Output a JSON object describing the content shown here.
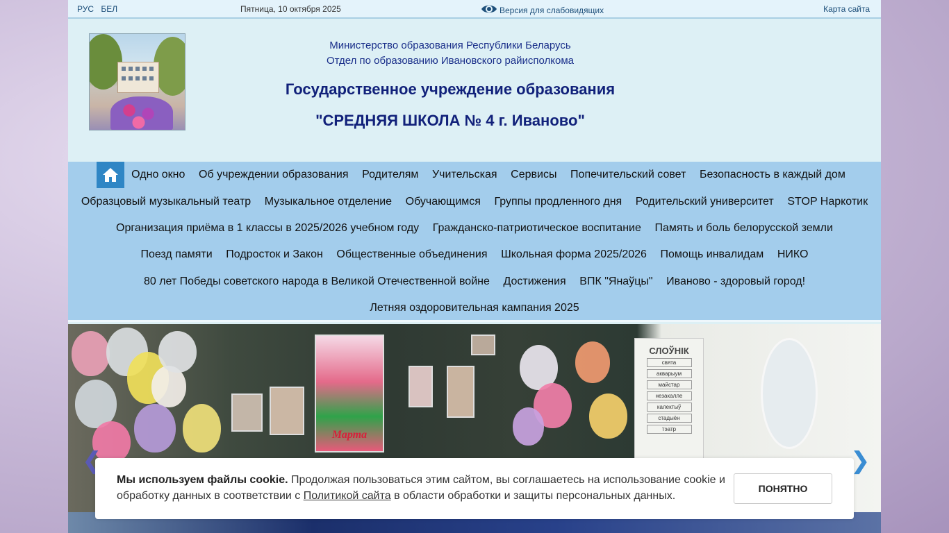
{
  "topbar": {
    "lang_ru": "РУС",
    "lang_be": "БЕЛ",
    "date": "Пятница, 10 октября 2025",
    "vision_label": "Версия для слабовидящих",
    "sitemap": "Карта сайта"
  },
  "header": {
    "ministry_line1": "Министерство образования Республики Беларусь",
    "ministry_line2": "Отдел по образованию Ивановского райисполкома",
    "title_line1": "Государственное учреждение образования",
    "title_line2": "\"СРЕДНЯЯ ШКОЛА № 4 г. Иваново\""
  },
  "nav": {
    "rows": [
      [
        "Одно окно",
        "Об учреждении образования",
        "Родителям",
        "Учительская",
        "Сервисы",
        "Попечительский совет",
        "Безопасность в каждый дом"
      ],
      [
        "Образцовый музыкальный театр",
        "Музыкальное отделение",
        "Обучающимся",
        "Группы продленного дня",
        "Родительский университет",
        "STOP Наркотик"
      ],
      [
        "Организация приёма в 1 классы в 2025/2026 учебном году",
        "Гражданско-патриотическое воспитание",
        "Память и боль белорусской земли"
      ],
      [
        "Поезд памяти",
        "Подросток и Закон",
        "Общественные объединения",
        "Школьная форма 2025/2026",
        "Помощь инвалидам",
        "НИКО"
      ],
      [
        "80 лет Победы советского народа в Великой Отечественной войне",
        "Достижения",
        "ВПК \"Янаўцы\"",
        "Иваново - здоровый город!"
      ],
      [
        "Летняя оздоровительная кампания 2025"
      ]
    ]
  },
  "slider": {
    "board_heading": "СЛОЎНІК",
    "board_words": [
      "свята",
      "акварыум",
      "майстар",
      "незакалле",
      "калектыў",
      "стадыён",
      "тэатр"
    ],
    "card_caption": "Марта"
  },
  "cookie": {
    "bold": "Мы используем файлы cookie.",
    "text_before": " Продолжая пользоваться этим сайтом, вы соглашаетесь на использование cookie и обработку данных в соответствии с ",
    "link": "Политикой сайта",
    "text_after": " в области обработки и защиты персональных данных.",
    "button": "ПОНЯТНО"
  },
  "colors": {
    "nav_bg": "#a3cdec",
    "home_btn": "#2f86c5",
    "header_bg": "#ddf0f5",
    "title_color": "#11217a"
  },
  "icons": {
    "home": "home-icon",
    "vision": "eye-icon",
    "prev": "chevron-left-icon",
    "next": "chevron-right-icon"
  }
}
